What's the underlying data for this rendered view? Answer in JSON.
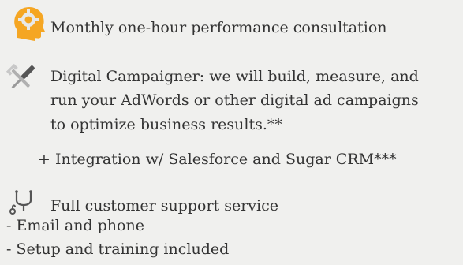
{
  "features": {
    "consultation": {
      "icon": "head-gear-icon",
      "text": "Monthly one-hour performance consultation"
    },
    "campaigner": {
      "icon": "tools-icon",
      "lines": [
        "Digital Campaigner: we will build, measure, and",
        "run your AdWords or other digital ad campaigns",
        "to optimize business results.**"
      ]
    },
    "integration": {
      "text": "+ Integration w/ Salesforce and Sugar CRM***"
    },
    "support": {
      "icon": "stethoscope-icon",
      "text": "Full customer support service",
      "sub_items": [
        "- Email and phone",
        "- Setup and training included"
      ]
    }
  },
  "colors": {
    "text": "#333333",
    "background": "#f0f0ee",
    "accent": "#f5a623"
  }
}
